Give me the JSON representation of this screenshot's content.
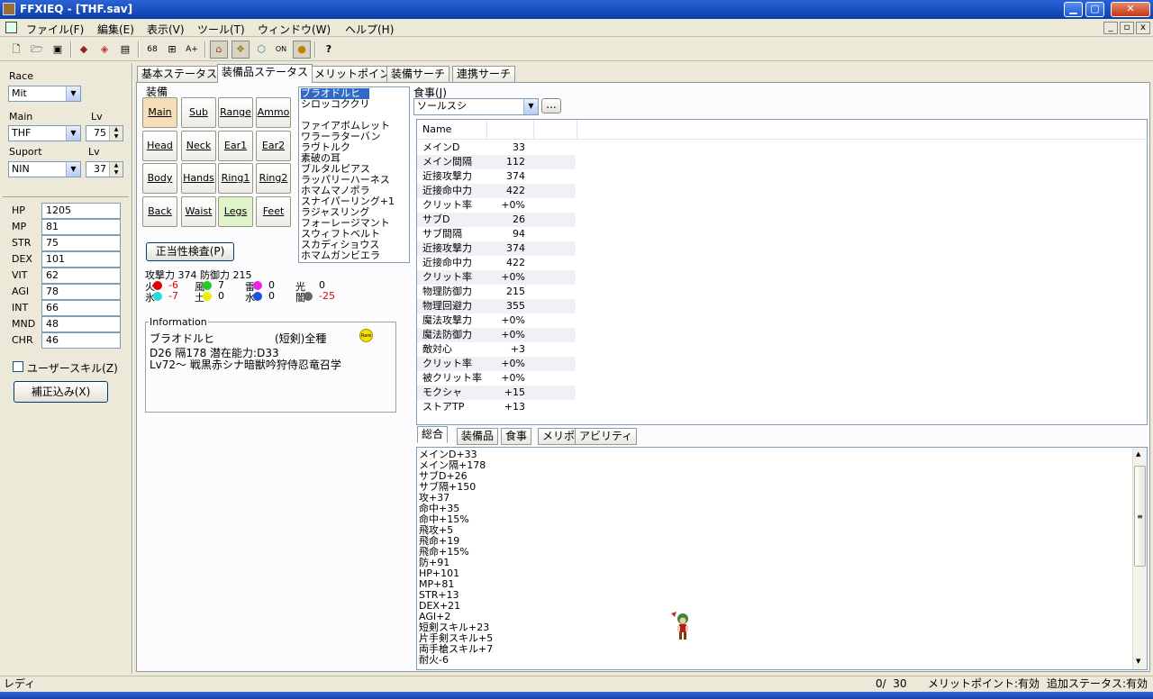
{
  "window": {
    "title": "FFXIEQ - [THF.sav]",
    "min": "▁",
    "max": "▢",
    "close": "✕"
  },
  "menu": [
    "ファイル(F)",
    "編集(E)",
    "表示(V)",
    "ツール(T)",
    "ウィンドウ(W)",
    "ヘルプ(H)"
  ],
  "toolbar": {
    "icons": [
      "new-file-icon",
      "open-folder-icon",
      "save-icon",
      "equip-set-icon",
      "equip-compare-icon",
      "equip-list-icon",
      "level68-icon",
      "merit-icon",
      "ability-icon",
      "home-icon",
      "gem-icon",
      "cube-icon",
      "ol-icon",
      "food-icon",
      "help-icon"
    ],
    "l68": "68",
    "on": "ON",
    "q": "?"
  },
  "left": {
    "race_label": "Race",
    "race_value": "Mit",
    "main_label": "Main",
    "lv_label": "Lv",
    "main_value": "THF",
    "main_lv": "75",
    "suport_label": "Suport",
    "sub_value": "NIN",
    "sub_lv": "37",
    "stats": [
      {
        "k": "HP",
        "v": "1205"
      },
      {
        "k": "MP",
        "v": "81"
      },
      {
        "k": "STR",
        "v": "75"
      },
      {
        "k": "DEX",
        "v": "101"
      },
      {
        "k": "VIT",
        "v": "62"
      },
      {
        "k": "AGI",
        "v": "78"
      },
      {
        "k": "INT",
        "v": "66"
      },
      {
        "k": "MND",
        "v": "48"
      },
      {
        "k": "CHR",
        "v": "46"
      }
    ],
    "user_skill": "ユーザースキル(Z)",
    "correction_button": "補正込み(X)"
  },
  "tabs": [
    "基本ステータス",
    "装備品ステータス",
    "メリットポイント",
    "装備サーチ",
    "連携サーチ"
  ],
  "equip": {
    "group_label": "装備",
    "slots": [
      [
        "Main",
        "Sub",
        "Range",
        "Ammo"
      ],
      [
        "Head",
        "Neck",
        "Ear1",
        "Ear2"
      ],
      [
        "Body",
        "Hands",
        "Ring1",
        "Ring2"
      ],
      [
        "Back",
        "Waist",
        "Legs",
        "Feet"
      ]
    ],
    "validate_button": "正当性検査(P)",
    "atk_line": "攻撃力 374 防御力 215",
    "elements": [
      {
        "name": "火",
        "val": "-6",
        "color": "#e00000",
        "neg": true
      },
      {
        "name": "風",
        "val": "7",
        "color": "#22cc22",
        "neg": false
      },
      {
        "name": "雷",
        "val": "0",
        "color": "#ee22ee",
        "neg": false
      },
      {
        "name": "光",
        "val": "0",
        "color": "",
        "neg": false
      },
      {
        "name": "氷",
        "val": "-7",
        "color": "#22dddd",
        "neg": true
      },
      {
        "name": "土",
        "val": "0",
        "color": "#eeee00",
        "neg": false
      },
      {
        "name": "水",
        "val": "0",
        "color": "#1a55e0",
        "neg": false
      },
      {
        "name": "闇",
        "val": "-25",
        "color": "#666666",
        "neg": true
      }
    ],
    "info_label": "Information",
    "info_name": "ブラオドルヒ",
    "info_type": "(短剣)全種",
    "info_badge": "Rare",
    "info_line1": "D26 隔178 潜在能力:D33",
    "info_line2": "Lv72～ 戦黒赤シナ暗獣吟狩侍忍竜召学"
  },
  "item_list": [
    "ブラオドルヒ",
    "シロッコククリ",
    "",
    "ファイアボムレット",
    "ワラーラターバン",
    "ラヴトルク",
    "素破の耳",
    "ブルタルピアス",
    "ラッパリーハーネス",
    "ホマムマノポラ",
    "スナイパーリング+1",
    "ラジャスリング",
    "フォーレージマント",
    "スウィフトベルト",
    "スカディショウス",
    "ホマムガンビエラ"
  ],
  "food": {
    "label": "食事(J)",
    "value": "ソールスシ",
    "more": "..."
  },
  "grid": {
    "header": "Name",
    "rows": [
      {
        "n": "メインD",
        "v": "33"
      },
      {
        "n": "メイン間隔",
        "v": "112"
      },
      {
        "n": "近接攻撃力",
        "v": "374"
      },
      {
        "n": "近接命中力",
        "v": "422"
      },
      {
        "n": "クリット率",
        "v": "+0%"
      },
      {
        "n": "サブD",
        "v": "26"
      },
      {
        "n": "サブ間隔",
        "v": "94"
      },
      {
        "n": "近接攻撃力",
        "v": "374"
      },
      {
        "n": "近接命中力",
        "v": "422"
      },
      {
        "n": "クリット率",
        "v": "+0%"
      },
      {
        "n": "物理防御力",
        "v": "215"
      },
      {
        "n": "物理回避力",
        "v": "355"
      },
      {
        "n": "魔法攻撃力",
        "v": "+0%"
      },
      {
        "n": "魔法防御力",
        "v": "+0%"
      },
      {
        "n": "敵対心",
        "v": "+3"
      },
      {
        "n": "クリット率",
        "v": "+0%"
      },
      {
        "n": "被クリット率",
        "v": "+0%"
      },
      {
        "n": "モクシャ",
        "v": "+15"
      },
      {
        "n": "ストアTP",
        "v": "+13"
      }
    ]
  },
  "subtabs": [
    "総合",
    "装備品",
    "食事",
    "メリポ",
    "アビリティ"
  ],
  "effects": [
    "メインD+33",
    "メイン隔+178",
    "サブD+26",
    "サブ隔+150",
    "攻+37",
    "命中+35",
    "命中+15%",
    "飛攻+5",
    "飛命+19",
    "飛命+15%",
    "防+91",
    "HP+101",
    "MP+81",
    "STR+13",
    "DEX+21",
    "AGI+2",
    "短剣スキル+23",
    "片手剣スキル+5",
    "両手槍スキル+7",
    "耐火-6"
  ],
  "status": {
    "left": "レディ",
    "count": "0/  30",
    "merit": "メリットポイント:有効",
    "extra": "追加ステータス:有効"
  }
}
